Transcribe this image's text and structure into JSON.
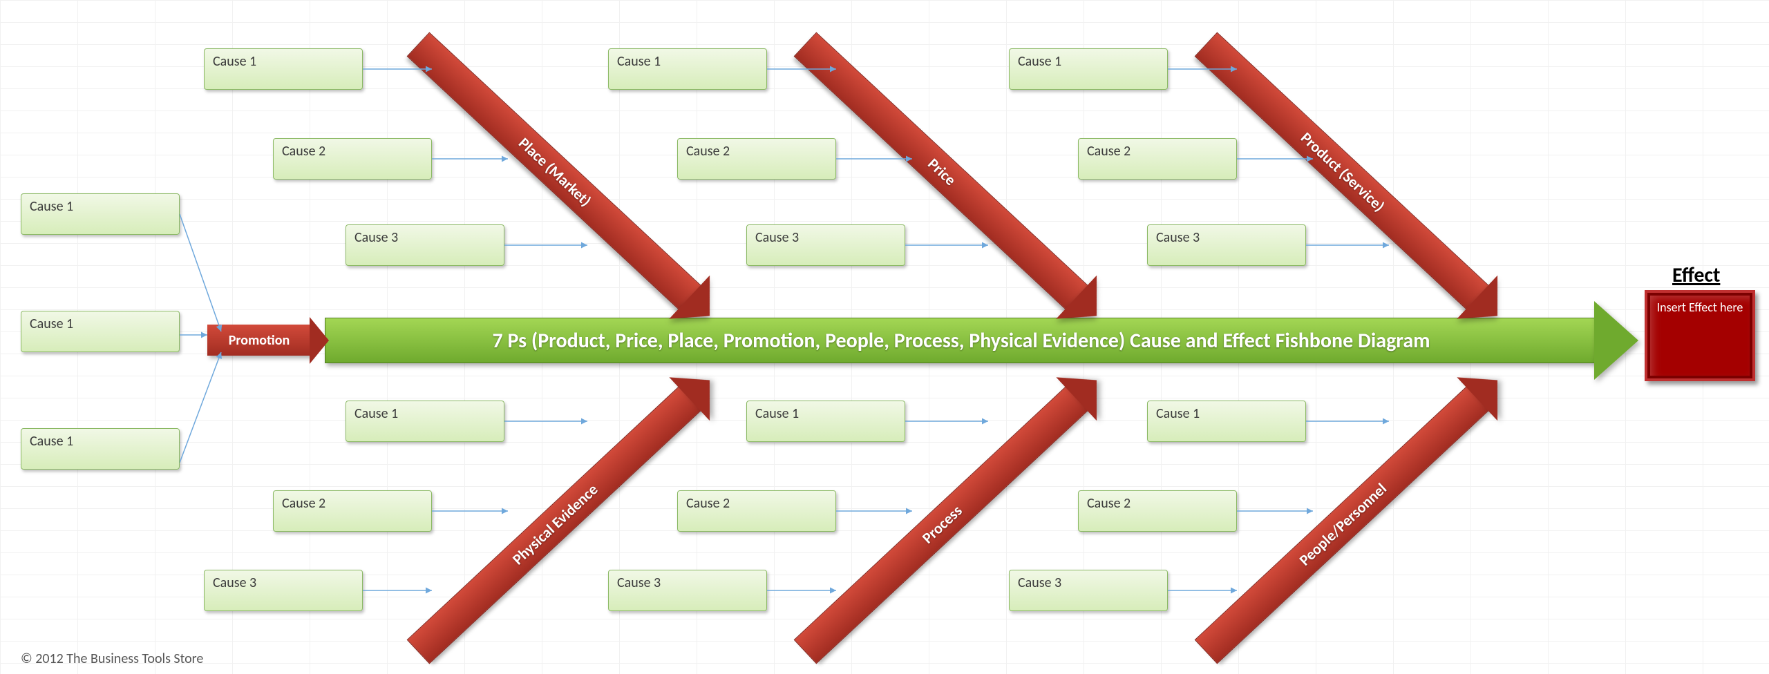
{
  "spine_text": "7 Ps (Product, Price, Place, Promotion, People, Process, Physical Evidence) Cause and Effect Fishbone Diagram",
  "effect": {
    "title": "Effect",
    "placeholder": "Insert Effect here"
  },
  "bones": {
    "promotion": {
      "label": "Promotion"
    },
    "place": {
      "label": "Place (Market)"
    },
    "price": {
      "label": "Price"
    },
    "product": {
      "label": "Product (Service)"
    },
    "physical": {
      "label": "Physical Evidence"
    },
    "process": {
      "label": "Process"
    },
    "people": {
      "label": "People/Personnel"
    }
  },
  "causes": {
    "promotion": [
      "Cause 1",
      "Cause 1",
      "Cause 1"
    ],
    "place": [
      "Cause 1",
      "Cause 2",
      "Cause 3"
    ],
    "price": [
      "Cause 1",
      "Cause 2",
      "Cause 3"
    ],
    "product": [
      "Cause 1",
      "Cause 2",
      "Cause 3"
    ],
    "physical": [
      "Cause 1",
      "Cause 2",
      "Cause 3"
    ],
    "process": [
      "Cause 1",
      "Cause 2",
      "Cause 3"
    ],
    "people": [
      "Cause 1",
      "Cause 2",
      "Cause 3"
    ]
  },
  "copyright": "© 2012 The Business Tools Store"
}
